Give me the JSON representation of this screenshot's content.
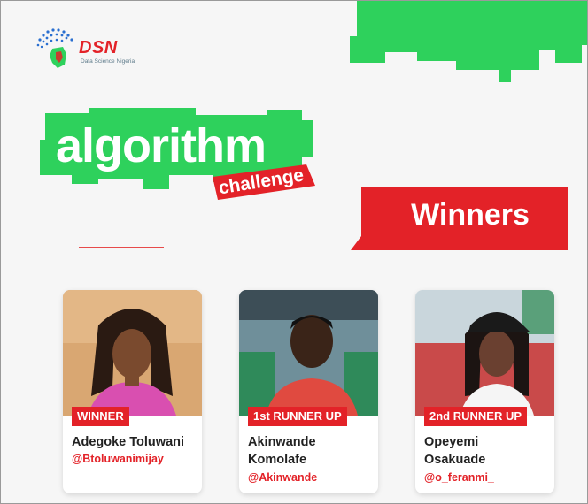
{
  "brand": {
    "logo_text": "DSN",
    "logo_subtext": "Data Science Nigeria"
  },
  "title": {
    "main": "algorithm",
    "sub": "challenge"
  },
  "banner": {
    "label": "Winners"
  },
  "winners": [
    {
      "rank": "WINNER",
      "name_line1": "Adegoke Toluwani",
      "name_line2": "",
      "handle": "@Btoluwanimijay"
    },
    {
      "rank": "1st RUNNER UP",
      "name_line1": "Akinwande",
      "name_line2": "Komolafe",
      "handle": "@Akinwande"
    },
    {
      "rank": "2nd RUNNER UP",
      "name_line1": "Opeyemi",
      "name_line2": "Osakuade",
      "handle": "@o_feranmi_"
    }
  ],
  "colors": {
    "brand_green": "#2ed15c",
    "brand_red": "#e32228",
    "background": "#f6f6f6"
  }
}
